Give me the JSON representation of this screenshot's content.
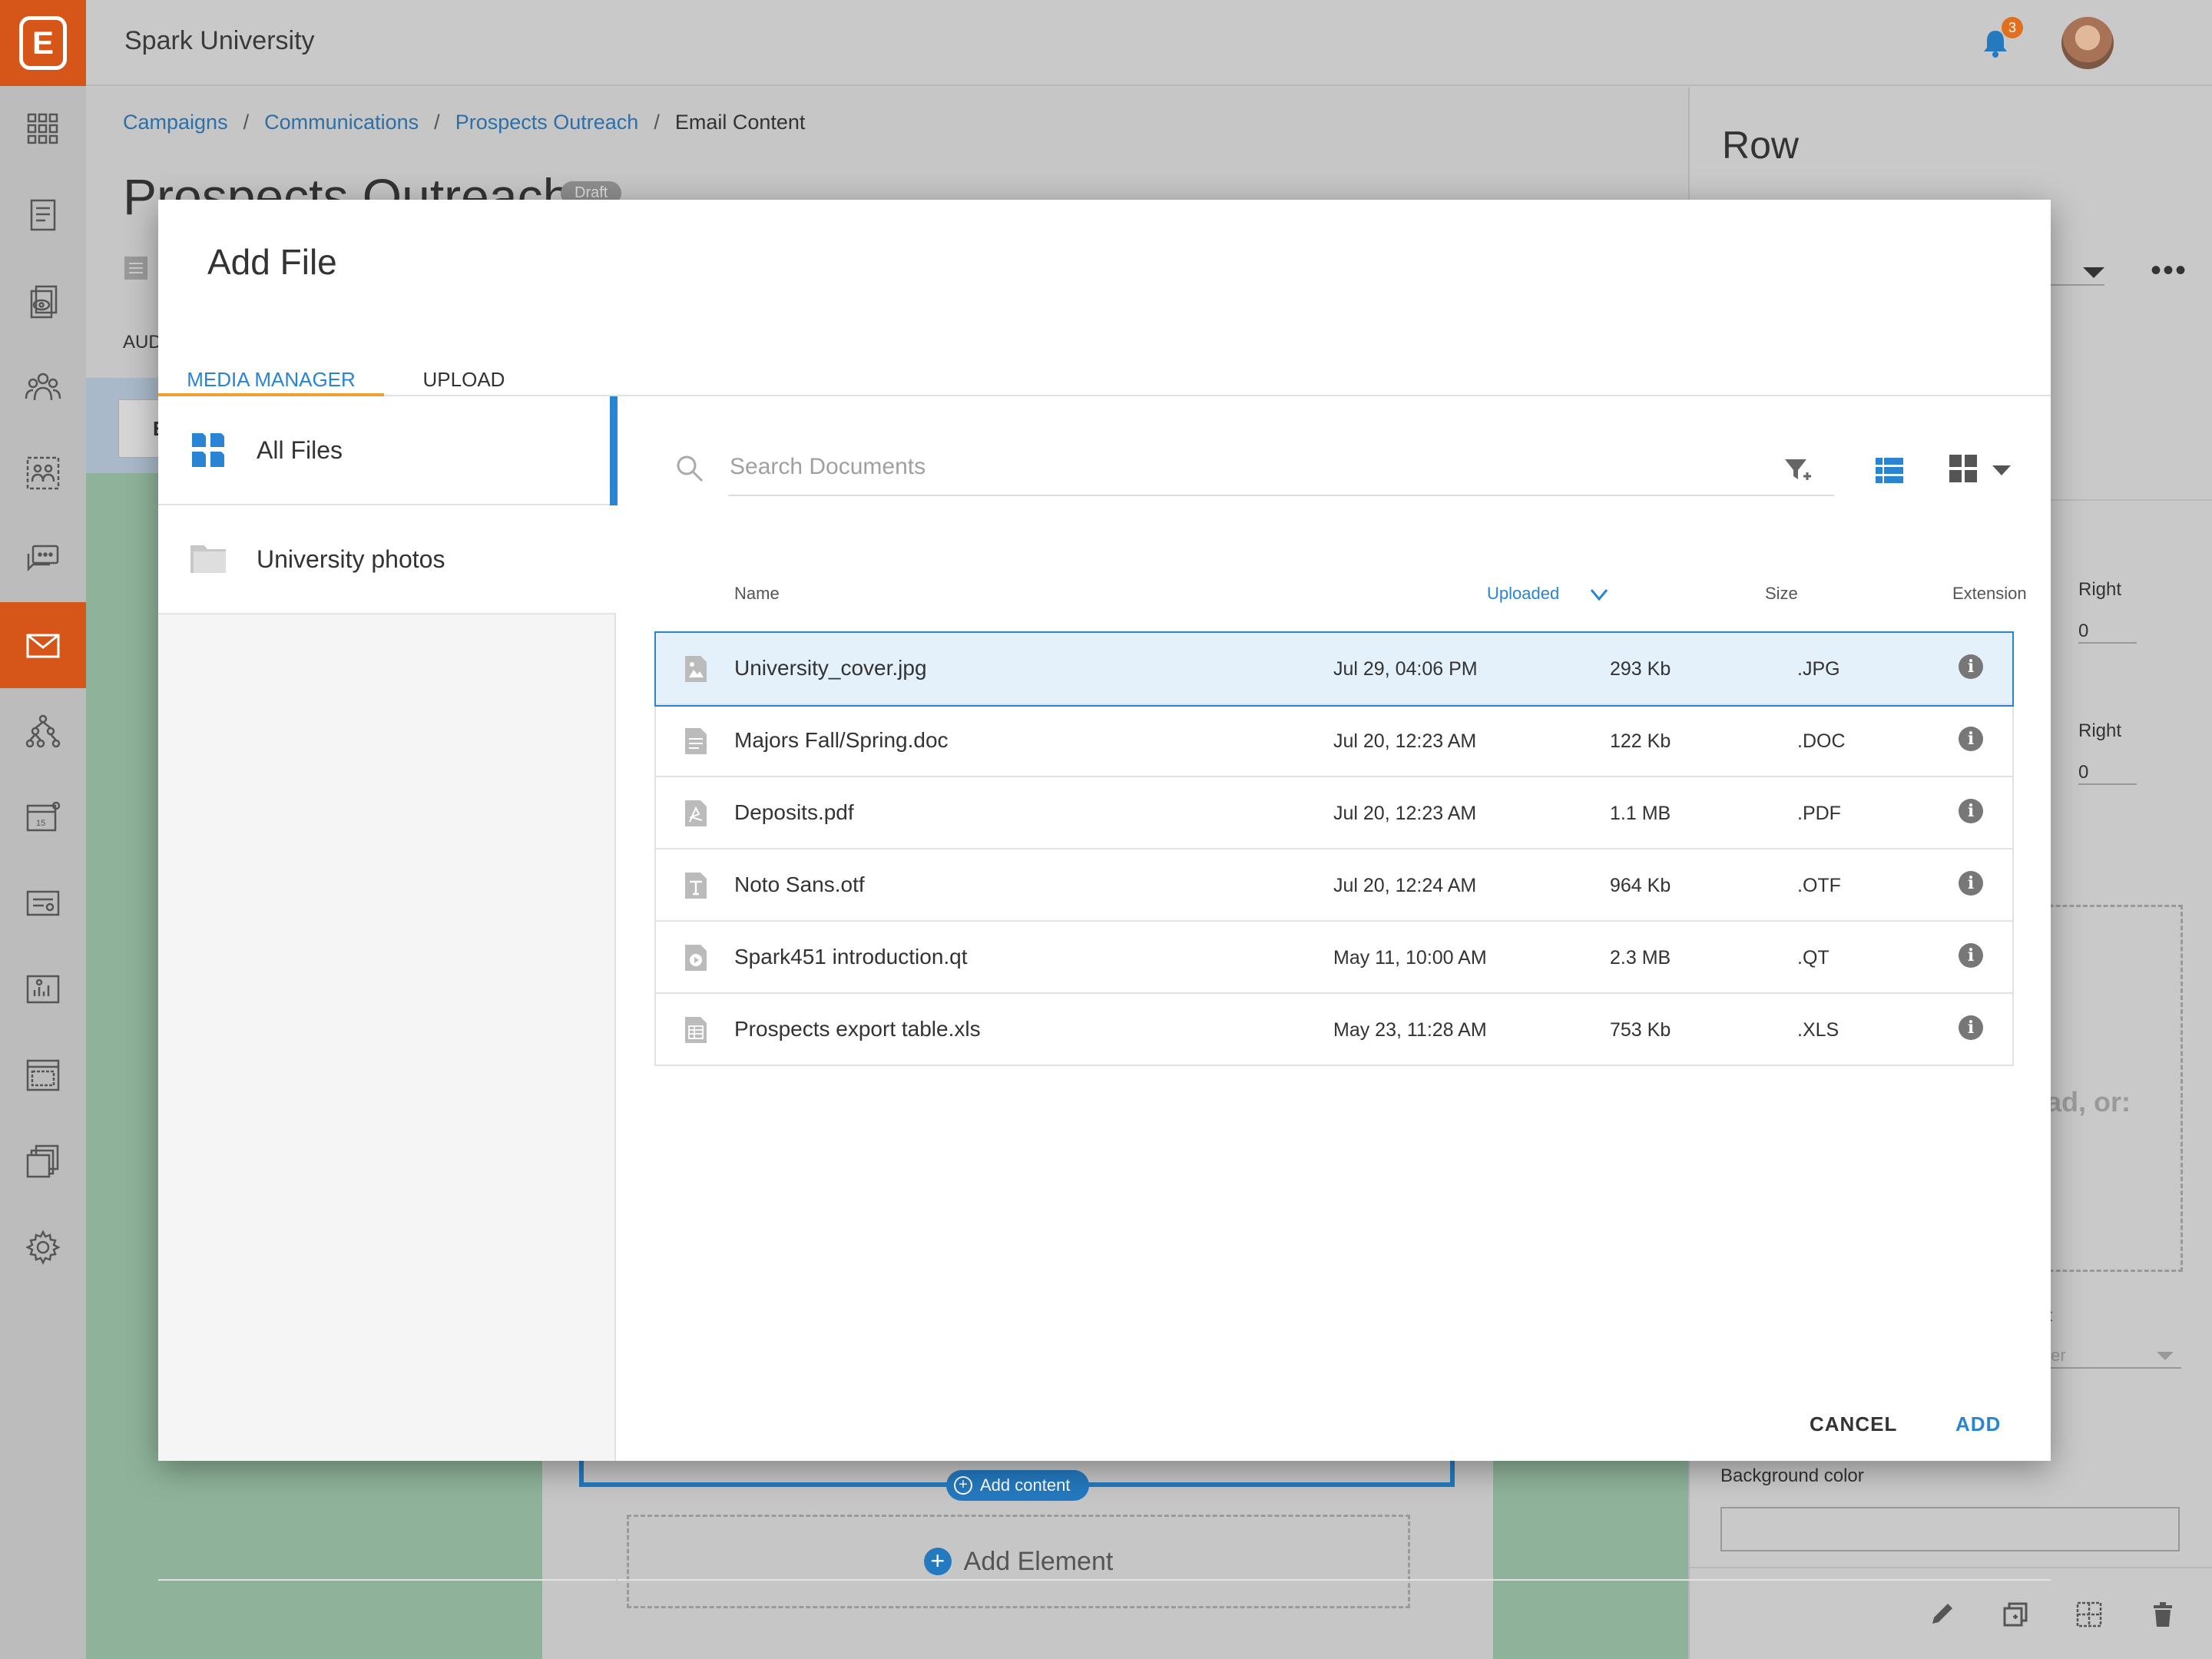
{
  "app": {
    "brand": "Spark University",
    "logo_letter": "E",
    "notification_count": "3"
  },
  "breadcrumb": {
    "items": [
      "Campaigns",
      "Communications",
      "Prospects Outreach"
    ],
    "current": "Email Content",
    "separator": "/"
  },
  "page": {
    "title": "Prospects Outreach",
    "status": "Draft",
    "aud_label": "AUD",
    "btn_label": "E"
  },
  "canvas": {
    "add_content": "Add content",
    "add_element": "Add Element"
  },
  "right_panel": {
    "title": "Row",
    "right_label_1": "Right",
    "right_value_1": "0",
    "right_label_2": "Right",
    "right_value_2": "0",
    "dropzone_text": "ad, or:",
    "small_label": "t",
    "select_value": "ter",
    "bg_color_label": "Background color"
  },
  "modal": {
    "title": "Add File",
    "tabs": [
      "MEDIA MANAGER",
      "UPLOAD"
    ],
    "sidebar": [
      "All Files",
      "University photos"
    ],
    "search_placeholder": "Search Documents",
    "columns": {
      "name": "Name",
      "uploaded": "Uploaded",
      "size": "Size",
      "extension": "Extension"
    },
    "files": [
      {
        "name": "University_cover.jpg",
        "uploaded": "Jul 29, 04:06 PM",
        "size": "293 Kb",
        "ext": ".JPG",
        "icon": "image-file-icon"
      },
      {
        "name": "Majors Fall/Spring.doc",
        "uploaded": "Jul 20, 12:23 AM",
        "size": "122 Kb",
        "ext": ".DOC",
        "icon": "document-file-icon"
      },
      {
        "name": "Deposits.pdf",
        "uploaded": "Jul 20, 12:23 AM",
        "size": "1.1 MB",
        "ext": ".PDF",
        "icon": "pdf-file-icon"
      },
      {
        "name": "Noto Sans.otf",
        "uploaded": "Jul 20, 12:24 AM",
        "size": "964 Kb",
        "ext": ".OTF",
        "icon": "font-file-icon"
      },
      {
        "name": "Spark451 introduction.qt",
        "uploaded": "May 11, 10:00 AM",
        "size": "2.3 MB",
        "ext": ".QT",
        "icon": "video-file-icon"
      },
      {
        "name": "Prospects export table.xls",
        "uploaded": "May 23, 11:28 AM",
        "size": "753 Kb",
        "ext": ".XLS",
        "icon": "spreadsheet-file-icon"
      }
    ],
    "cancel_label": "CANCEL",
    "add_label": "ADD"
  },
  "colors": {
    "accent": "#2985d3",
    "brand_orange": "#d6561a",
    "selected_row": "#e4f1fb"
  }
}
